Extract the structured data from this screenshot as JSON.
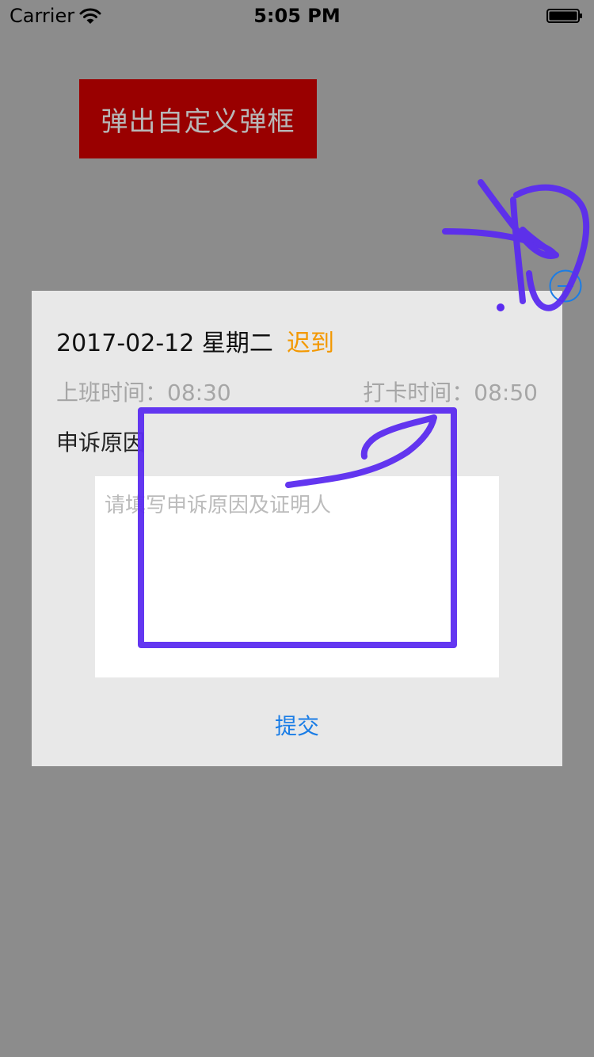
{
  "status_bar": {
    "carrier": "Carrier",
    "time": "5:05 PM"
  },
  "main": {
    "popup_button_label": "弹出自定义弹框"
  },
  "dialog": {
    "date": "2017-02-12 星期二",
    "status_tag": "迟到",
    "work_time": "上班时间：08:30",
    "punch_time": "打卡时间：08:50",
    "reason_label": "申诉原因",
    "reason_placeholder": "请填写申诉原因及证明人",
    "reason_value": "",
    "submit_label": "提交"
  },
  "colors": {
    "background_overlay": "#8c8c8c",
    "trigger_button": "#990000",
    "dialog_background": "#e8e8e8",
    "late_tag": "#f39800",
    "submit_link": "#1a7de6",
    "annotation_stroke": "#5b2cf0"
  },
  "icons": {
    "wifi": "wifi-icon",
    "battery": "battery-icon",
    "close": "close-icon"
  }
}
